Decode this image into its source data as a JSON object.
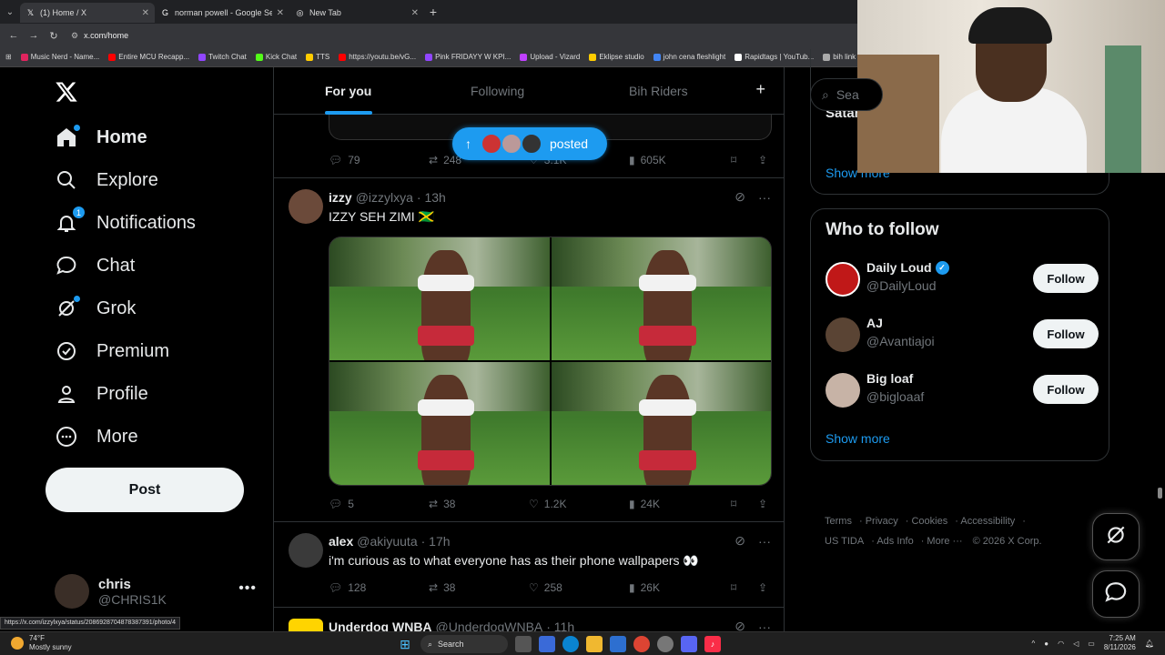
{
  "browser": {
    "tabs": [
      {
        "title": "(1) Home / X",
        "favicon": "x-logo-icon",
        "active": true
      },
      {
        "title": "norman powell - Google Search",
        "favicon": "google-icon",
        "active": false
      },
      {
        "title": "New Tab",
        "favicon": "chrome-icon",
        "active": false
      }
    ],
    "url": "x.com/home",
    "bookmarks": [
      {
        "label": "Music Nerd - Name...",
        "color": "#e0245e"
      },
      {
        "label": "Entire MCU Recapp...",
        "color": "#ff0000"
      },
      {
        "label": "Twitch Chat",
        "color": "#9146ff"
      },
      {
        "label": "Kick Chat",
        "color": "#53fc18"
      },
      {
        "label": "TTS",
        "color": "#ffcc00"
      },
      {
        "label": "https://youtu.be/vG...",
        "color": "#ff0000"
      },
      {
        "label": "Pink FRIDAYY W KPI...",
        "color": "#9146ff"
      },
      {
        "label": "Upload - Vizard",
        "color": "#c040ff"
      },
      {
        "label": "Eklipse studio",
        "color": "#ffcc00"
      },
      {
        "label": "john cena fleshlight",
        "color": "#4285f4"
      },
      {
        "label": "Rapidtags | YouTub...",
        "color": "#ffffff"
      },
      {
        "label": "bih link",
        "color": "#aaaaaa"
      }
    ],
    "status_url": "https://x.com/izzylxya/status/2086928704878387391/photo/4"
  },
  "nav": {
    "items": [
      {
        "label": "Home",
        "icon": "home-icon"
      },
      {
        "label": "Explore",
        "icon": "search-icon"
      },
      {
        "label": "Notifications",
        "icon": "bell-icon",
        "badge": "1"
      },
      {
        "label": "Chat",
        "icon": "chat-bubble-icon"
      },
      {
        "label": "Grok",
        "icon": "grok-icon"
      },
      {
        "label": "Premium",
        "icon": "verified-icon"
      },
      {
        "label": "Profile",
        "icon": "person-icon"
      },
      {
        "label": "More",
        "icon": "more-circle-icon"
      }
    ],
    "post_label": "Post",
    "account": {
      "name": "chris",
      "handle": "@CHRIS1K"
    }
  },
  "feed": {
    "tabs": [
      "For you",
      "Following",
      "Bih Riders"
    ],
    "new_posts_label": "posted",
    "prev_post": {
      "replies": "79",
      "reposts": "248",
      "likes": "3.1K",
      "views": "605K"
    },
    "tweets": [
      {
        "name": "izzy",
        "handle": "@izzylxya",
        "time": "· 13h",
        "text": "IZZY SEH ZIMI 🇯🇲",
        "replies": "5",
        "reposts": "38",
        "likes": "1.2K",
        "views": "24K"
      },
      {
        "name": "alex",
        "handle": "@akiyuuta",
        "time": "· 17h",
        "text": "i'm curious as to what everyone has as their phone wallpapers 👀",
        "replies": "128",
        "reposts": "38",
        "likes": "258",
        "views": "26K"
      },
      {
        "name": "Underdog WNBA",
        "handle": "@UnderdogWNBA",
        "time": "· 11h"
      }
    ]
  },
  "sidebar": {
    "search_placeholder": "Sea",
    "trend_fragment": "Satar",
    "show_more": "Show more",
    "who_to_follow": {
      "title": "Who to follow",
      "accounts": [
        {
          "name": "Daily Loud",
          "handle": "@DailyLoud",
          "verified": true,
          "button": "Follow"
        },
        {
          "name": "AJ",
          "handle": "@Avantiajoi",
          "verified": false,
          "button": "Follow"
        },
        {
          "name": "Big loaf",
          "handle": "@bigloaaf",
          "verified": false,
          "button": "Follow"
        }
      ],
      "show_more": "Show more"
    },
    "footer": {
      "links": [
        "Terms",
        "Privacy",
        "Cookies",
        "Accessibility",
        "US TIDA",
        "Ads Info",
        "More ···"
      ],
      "copyright": "© 2026 X Corp."
    }
  },
  "taskbar": {
    "weather_temp": "74°F",
    "weather_desc": "Mostly sunny",
    "search_label": "Search",
    "time": "7:25 AM",
    "date": "8/11/2026"
  },
  "colors": {
    "accent": "#1d9bf0",
    "bg": "#000000",
    "border": "#2f3336",
    "muted": "#71767b"
  }
}
